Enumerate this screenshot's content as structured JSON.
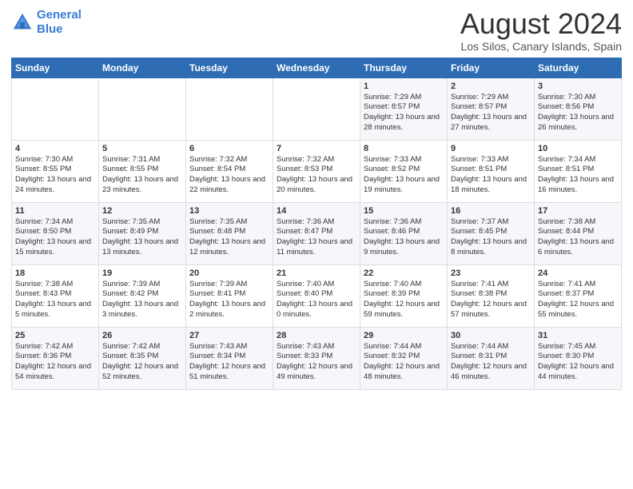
{
  "logo": {
    "line1": "General",
    "line2": "Blue"
  },
  "title": "August 2024",
  "subtitle": "Los Silos, Canary Islands, Spain",
  "days_of_week": [
    "Sunday",
    "Monday",
    "Tuesday",
    "Wednesday",
    "Thursday",
    "Friday",
    "Saturday"
  ],
  "weeks": [
    [
      {
        "day": "",
        "info": ""
      },
      {
        "day": "",
        "info": ""
      },
      {
        "day": "",
        "info": ""
      },
      {
        "day": "",
        "info": ""
      },
      {
        "day": "1",
        "info": "Sunrise: 7:29 AM\nSunset: 8:57 PM\nDaylight: 13 hours\nand 28 minutes."
      },
      {
        "day": "2",
        "info": "Sunrise: 7:29 AM\nSunset: 8:57 PM\nDaylight: 13 hours\nand 27 minutes."
      },
      {
        "day": "3",
        "info": "Sunrise: 7:30 AM\nSunset: 8:56 PM\nDaylight: 13 hours\nand 26 minutes."
      }
    ],
    [
      {
        "day": "4",
        "info": "Sunrise: 7:30 AM\nSunset: 8:55 PM\nDaylight: 13 hours\nand 24 minutes."
      },
      {
        "day": "5",
        "info": "Sunrise: 7:31 AM\nSunset: 8:55 PM\nDaylight: 13 hours\nand 23 minutes."
      },
      {
        "day": "6",
        "info": "Sunrise: 7:32 AM\nSunset: 8:54 PM\nDaylight: 13 hours\nand 22 minutes."
      },
      {
        "day": "7",
        "info": "Sunrise: 7:32 AM\nSunset: 8:53 PM\nDaylight: 13 hours\nand 20 minutes."
      },
      {
        "day": "8",
        "info": "Sunrise: 7:33 AM\nSunset: 8:52 PM\nDaylight: 13 hours\nand 19 minutes."
      },
      {
        "day": "9",
        "info": "Sunrise: 7:33 AM\nSunset: 8:51 PM\nDaylight: 13 hours\nand 18 minutes."
      },
      {
        "day": "10",
        "info": "Sunrise: 7:34 AM\nSunset: 8:51 PM\nDaylight: 13 hours\nand 16 minutes."
      }
    ],
    [
      {
        "day": "11",
        "info": "Sunrise: 7:34 AM\nSunset: 8:50 PM\nDaylight: 13 hours\nand 15 minutes."
      },
      {
        "day": "12",
        "info": "Sunrise: 7:35 AM\nSunset: 8:49 PM\nDaylight: 13 hours\nand 13 minutes."
      },
      {
        "day": "13",
        "info": "Sunrise: 7:35 AM\nSunset: 8:48 PM\nDaylight: 13 hours\nand 12 minutes."
      },
      {
        "day": "14",
        "info": "Sunrise: 7:36 AM\nSunset: 8:47 PM\nDaylight: 13 hours\nand 11 minutes."
      },
      {
        "day": "15",
        "info": "Sunrise: 7:36 AM\nSunset: 8:46 PM\nDaylight: 13 hours\nand 9 minutes."
      },
      {
        "day": "16",
        "info": "Sunrise: 7:37 AM\nSunset: 8:45 PM\nDaylight: 13 hours\nand 8 minutes."
      },
      {
        "day": "17",
        "info": "Sunrise: 7:38 AM\nSunset: 8:44 PM\nDaylight: 13 hours\nand 6 minutes."
      }
    ],
    [
      {
        "day": "18",
        "info": "Sunrise: 7:38 AM\nSunset: 8:43 PM\nDaylight: 13 hours\nand 5 minutes."
      },
      {
        "day": "19",
        "info": "Sunrise: 7:39 AM\nSunset: 8:42 PM\nDaylight: 13 hours\nand 3 minutes."
      },
      {
        "day": "20",
        "info": "Sunrise: 7:39 AM\nSunset: 8:41 PM\nDaylight: 13 hours\nand 2 minutes."
      },
      {
        "day": "21",
        "info": "Sunrise: 7:40 AM\nSunset: 8:40 PM\nDaylight: 13 hours\nand 0 minutes."
      },
      {
        "day": "22",
        "info": "Sunrise: 7:40 AM\nSunset: 8:39 PM\nDaylight: 12 hours\nand 59 minutes."
      },
      {
        "day": "23",
        "info": "Sunrise: 7:41 AM\nSunset: 8:38 PM\nDaylight: 12 hours\nand 57 minutes."
      },
      {
        "day": "24",
        "info": "Sunrise: 7:41 AM\nSunset: 8:37 PM\nDaylight: 12 hours\nand 55 minutes."
      }
    ],
    [
      {
        "day": "25",
        "info": "Sunrise: 7:42 AM\nSunset: 8:36 PM\nDaylight: 12 hours\nand 54 minutes."
      },
      {
        "day": "26",
        "info": "Sunrise: 7:42 AM\nSunset: 8:35 PM\nDaylight: 12 hours\nand 52 minutes."
      },
      {
        "day": "27",
        "info": "Sunrise: 7:43 AM\nSunset: 8:34 PM\nDaylight: 12 hours\nand 51 minutes."
      },
      {
        "day": "28",
        "info": "Sunrise: 7:43 AM\nSunset: 8:33 PM\nDaylight: 12 hours\nand 49 minutes."
      },
      {
        "day": "29",
        "info": "Sunrise: 7:44 AM\nSunset: 8:32 PM\nDaylight: 12 hours\nand 48 minutes."
      },
      {
        "day": "30",
        "info": "Sunrise: 7:44 AM\nSunset: 8:31 PM\nDaylight: 12 hours\nand 46 minutes."
      },
      {
        "day": "31",
        "info": "Sunrise: 7:45 AM\nSunset: 8:30 PM\nDaylight: 12 hours\nand 44 minutes."
      }
    ]
  ]
}
